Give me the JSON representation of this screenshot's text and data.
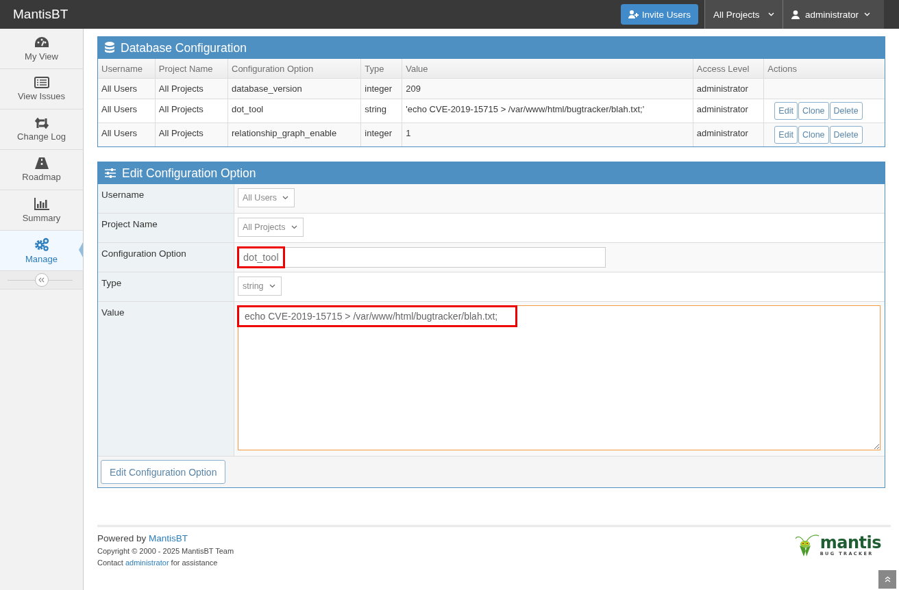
{
  "navbar": {
    "brand": "MantisBT",
    "invite_button": "Invite Users",
    "project_menu": "All Projects",
    "user_menu": "administrator"
  },
  "sidebar": {
    "items": [
      {
        "label": "My View",
        "selected": false
      },
      {
        "label": "View Issues",
        "selected": false
      },
      {
        "label": "Change Log",
        "selected": false
      },
      {
        "label": "Roadmap",
        "selected": false
      },
      {
        "label": "Summary",
        "selected": false
      },
      {
        "label": "Manage",
        "selected": true
      }
    ]
  },
  "db_config": {
    "title": "Database Configuration",
    "columns": [
      "Username",
      "Project Name",
      "Configuration Option",
      "Type",
      "Value",
      "Access Level",
      "Actions"
    ],
    "rows": [
      {
        "cells": [
          "All Users",
          "All Projects",
          "database_version",
          "integer",
          "209",
          "administrator"
        ]
      },
      {
        "cells": [
          "All Users",
          "All Projects",
          "dot_tool",
          "string",
          "'echo CVE-2019-15715 > /var/www/html/bugtracker/blah.txt;'",
          "administrator"
        ],
        "actions": [
          "Edit",
          "Clone",
          "Delete"
        ]
      },
      {
        "cells": [
          "All Users",
          "All Projects",
          "relationship_graph_enable",
          "integer",
          "1",
          "administrator"
        ],
        "actions": [
          "Edit",
          "Clone",
          "Delete"
        ]
      }
    ]
  },
  "edit_form": {
    "title": "Edit Configuration Option",
    "fields": [
      {
        "label": "Username",
        "kind": "select",
        "value": "All Users"
      },
      {
        "label": "Project Name",
        "kind": "select",
        "value": "All Projects"
      },
      {
        "label": "Configuration Option",
        "kind": "text",
        "value": "dot_tool",
        "highlighted": true
      },
      {
        "label": "Type",
        "kind": "select",
        "value": "string"
      },
      {
        "label": "Value",
        "kind": "textarea",
        "value": "echo CVE-2019-15715 > /var/www/html/bugtracker/blah.txt;",
        "highlighted": true
      }
    ],
    "submit": "Edit Configuration Option"
  },
  "footer": {
    "powered_prefix": "Powered by ",
    "powered_link": "MantisBT",
    "copyright": "Copyright © 2000 - 2025 MantisBT Team",
    "contact_prefix": "Contact ",
    "contact_link": "administrator",
    "contact_suffix": " for assistance",
    "logo_word": "mantis",
    "logo_tagline": "BUG TRACKER"
  }
}
